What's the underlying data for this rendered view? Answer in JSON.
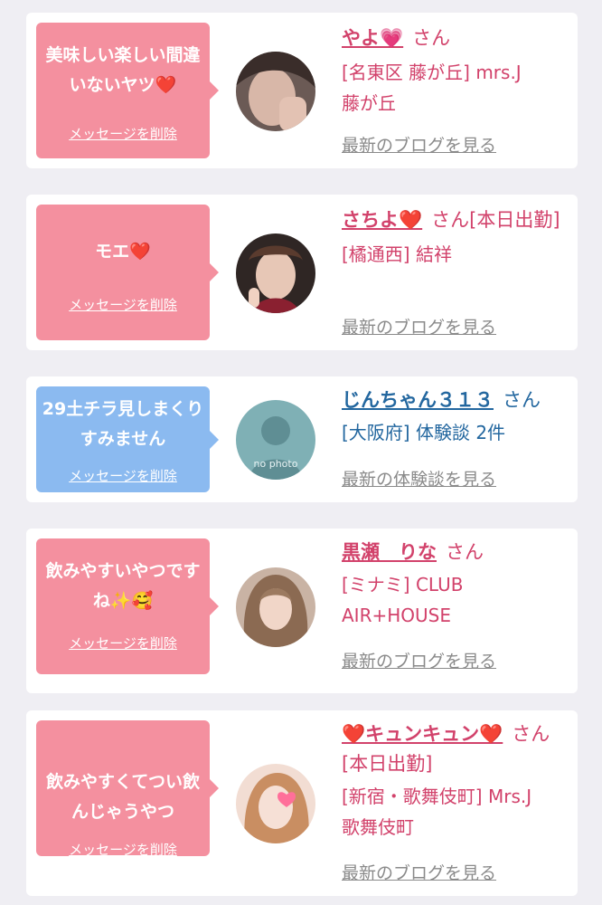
{
  "delete_label": "メッセージを削除",
  "colors": {
    "pink_bubble": "#f4909f",
    "blue_bubble": "#8bbaf0",
    "name_pink": "#d2426b",
    "name_blue": "#23679f",
    "link_gray": "#8a8a8a"
  },
  "items": [
    {
      "message": "美味しい楽しい間違いないヤツ❤️",
      "name": "やよ💗",
      "san": "さん",
      "meta": "[名東区 藤が丘] mrs.J\n藤が丘",
      "link": "最新のブログを見る",
      "avatar": "user-photo"
    },
    {
      "message": "モエ❤️",
      "name": "さちよ❤️",
      "san": "さん[本日出勤]",
      "meta": "[橘通西] 結祥",
      "link": "最新のブログを見る",
      "avatar": "user-photo"
    },
    {
      "message": "29土チラ見しまくりすみません",
      "name": "じんちゃん３１３",
      "san": "さん",
      "meta": "[大阪府] 体験談 2件",
      "link": "最新の体験談を見る",
      "avatar": "no-photo",
      "avatar_text": "no photo"
    },
    {
      "message": "飲みやすいやつですね✨🥰",
      "name": "黒瀬　りな",
      "san": "さん",
      "meta": "[ミナミ] CLUB\nAIR+HOUSE",
      "link": "最新のブログを見る",
      "avatar": "user-photo"
    },
    {
      "message": "飲みやすくてつい飲んじゃうやつ",
      "name": "❤️キュンキュン❤️",
      "san": "さん[本日出勤]",
      "meta": "[新宿・歌舞伎町] Mrs.J\n歌舞伎町",
      "link": "最新のブログを見る",
      "avatar": "user-photo"
    }
  ]
}
